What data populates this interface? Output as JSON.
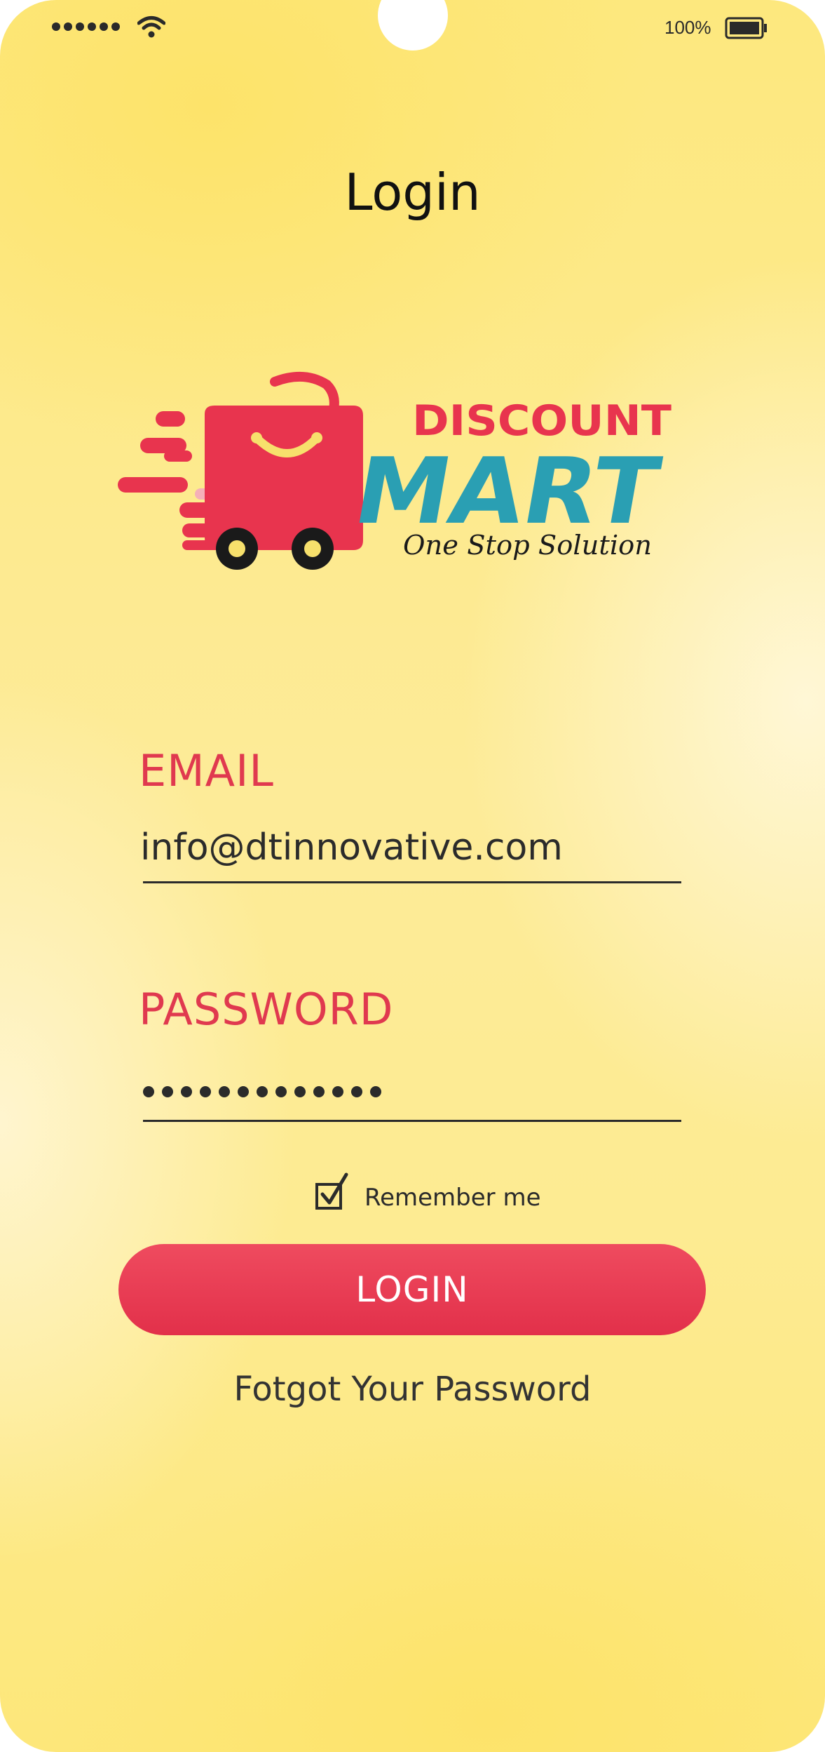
{
  "status_bar": {
    "signal_icon": "signal-dots-icon",
    "wifi_icon": "wifi-icon",
    "battery_percent": "100%",
    "battery_icon": "battery-icon"
  },
  "header": {
    "title": "Login"
  },
  "logo": {
    "line1": "DISCOUNT",
    "line2": "MART",
    "tagline": "One Stop Solution",
    "icon": "shopping-bag-cart-icon",
    "colors": {
      "primary": "#e8344e",
      "secondary": "#2a9fb3",
      "wheel": "#1a1a1a"
    }
  },
  "form": {
    "email_label": "EMAIL",
    "email_value": "info@dtinnovative.com",
    "password_label": "PASSWORD",
    "password_length": 13,
    "remember_label": "Remember me",
    "remember_checked": true,
    "login_label": "LOGIN",
    "forgot_label": "Fotgot Your Password"
  },
  "theme": {
    "accent": "#e3344c",
    "background": "#fde98a"
  }
}
